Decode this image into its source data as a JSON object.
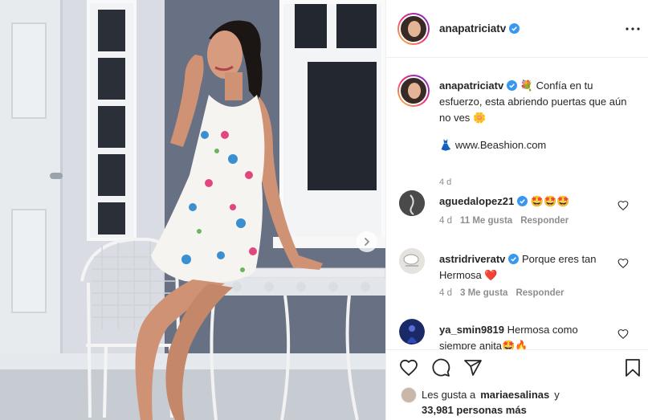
{
  "post": {
    "username": "anapatriciatv",
    "caption_username": "anapatriciatv",
    "caption_text": "Confía en tu esfuerzo, esta abriendo puertas que aún no ves",
    "caption_emoji_start": "💐",
    "caption_emoji_end": "🌼",
    "link_emoji": "👗",
    "link_text": "www.Beashion.com",
    "caption_time": "4 d"
  },
  "comments": [
    {
      "username": "aguedalopez21",
      "text": "🤩🤩🤩",
      "time": "4 d",
      "likes": "11 Me gusta",
      "reply": "Responder"
    },
    {
      "username": "astridriveratv",
      "text": "Porque eres tan Hermosa ❤️",
      "time": "4 d",
      "likes": "3 Me gusta",
      "reply": "Responder"
    },
    {
      "username": "ya_smin9819",
      "text": "Hermosa como siempre anita🤩🔥",
      "time": "",
      "likes": "",
      "reply": ""
    }
  ],
  "likes": {
    "prefix": "Les gusta a",
    "user": "mariaesalinas",
    "joiner": "y",
    "count": "33,981 personas más"
  },
  "icons": {
    "more": "more-horizontal-icon",
    "like": "heart-icon",
    "comment": "comment-icon",
    "share": "share-icon",
    "save": "bookmark-icon",
    "verified": "verified-badge-icon",
    "next": "chevron-right-icon"
  },
  "colors": {
    "verified": "#3897f0",
    "text": "#262626",
    "muted": "#8e8e8e",
    "border": "#efefef"
  }
}
